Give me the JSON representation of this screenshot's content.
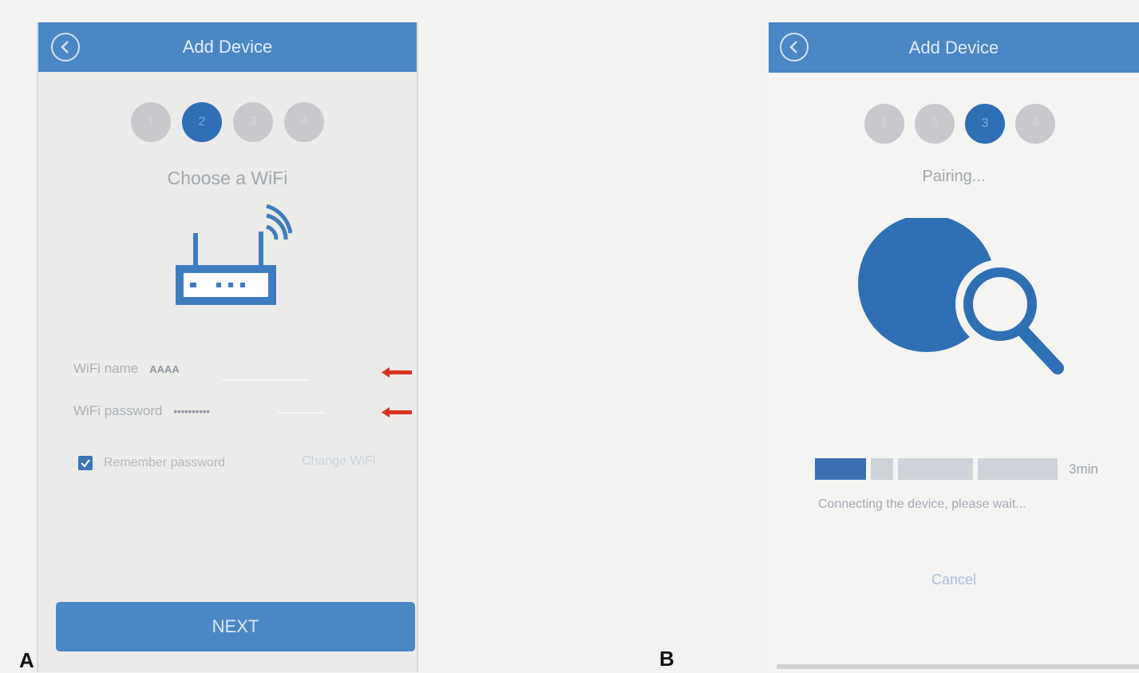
{
  "panels": {
    "a_label": "A",
    "b_label": "B"
  },
  "screen_a": {
    "title": "Add Device",
    "steps": [
      "1",
      "2",
      "3",
      "4"
    ],
    "active_step": 2,
    "step_title": "Choose a WiFi",
    "wifi_name_label": "WiFi name",
    "wifi_name_value": "AAAA",
    "wifi_password_label": "WiFi password",
    "wifi_password_value": "••••••••••",
    "remember_checked": true,
    "remember_label": "Remember password",
    "change_wifi_label": "Change WiFi",
    "next_label": "NEXT",
    "icons": {
      "back": "chevron-left-icon",
      "router": "wifi-router-icon",
      "arrow": "red-arrow-icon"
    },
    "colors": {
      "header": "#4b87c4",
      "accent": "#2f6fb4",
      "arrow": "#d9341f"
    }
  },
  "screen_b": {
    "title": "Add Device",
    "steps": [
      "1",
      "2",
      "3",
      "4"
    ],
    "active_step": 3,
    "step_title": "Pairing...",
    "progress_fraction": 0.2,
    "time_remaining": "3min",
    "connecting_text": "Connecting the device, please wait...",
    "cancel_label": "Cancel",
    "icons": {
      "back": "chevron-left-icon",
      "search": "search-device-icon"
    }
  }
}
